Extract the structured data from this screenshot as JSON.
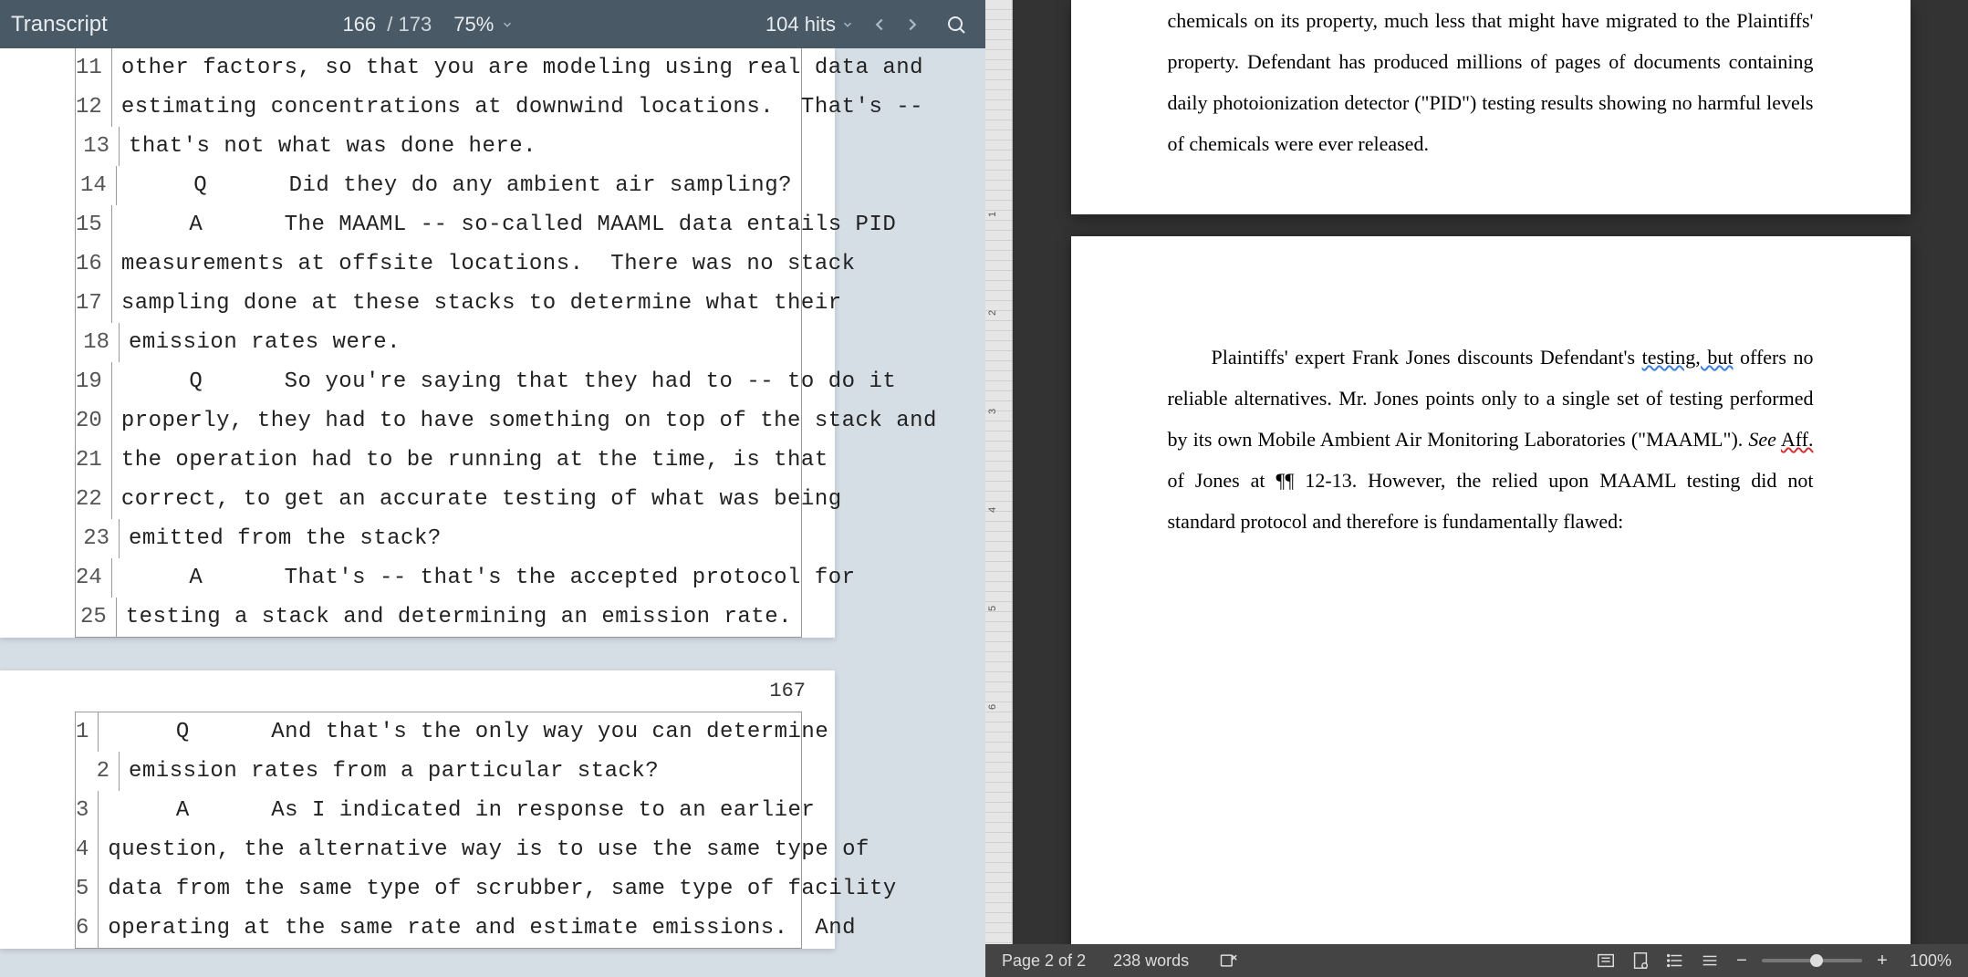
{
  "left": {
    "title": "Transcript",
    "current_page": "166",
    "page_sep": "/ 173",
    "zoom": "75%",
    "hits": "104 hits",
    "page166": {
      "lines": [
        {
          "n": "11",
          "t": "other factors, so that you are modeling using real data and"
        },
        {
          "n": "12",
          "t": "estimating concentrations at downwind locations.  That's --"
        },
        {
          "n": "13",
          "t": "that's not what was done here."
        },
        {
          "n": "14",
          "t": "     Q      Did they do any ambient air sampling?"
        },
        {
          "n": "15",
          "t": "     A      The MAAML -- so-called MAAML data entails PID"
        },
        {
          "n": "16",
          "t": "measurements at offsite locations.  There was no stack"
        },
        {
          "n": "17",
          "t": "sampling done at these stacks to determine what their"
        },
        {
          "n": "18",
          "t": "emission rates were."
        },
        {
          "n": "19",
          "t": "     Q      So you're saying that they had to -- to do it"
        },
        {
          "n": "20",
          "t": "properly, they had to have something on top of the stack and"
        },
        {
          "n": "21",
          "t": "the operation had to be running at the time, is that"
        },
        {
          "n": "22",
          "t": "correct, to get an accurate testing of what was being"
        },
        {
          "n": "23",
          "t": "emitted from the stack?"
        },
        {
          "n": "24",
          "t": "     A      That's -- that's the accepted protocol for"
        },
        {
          "n": "25",
          "t": "testing a stack and determining an emission rate."
        }
      ]
    },
    "page167": {
      "num": "167",
      "lines": [
        {
          "n": "1",
          "t": "     Q      And that's the only way you can determine"
        },
        {
          "n": "2",
          "t": "emission rates from a particular stack?"
        },
        {
          "n": "3",
          "t": "     A      As I indicated in response to an earlier"
        },
        {
          "n": "4",
          "t": "question, the alternative way is to use the same type of"
        },
        {
          "n": "5",
          "t": "data from the same type of scrubber, same type of facility"
        },
        {
          "n": "6",
          "t": "operating at the same rate and estimate emissions.  And"
        }
      ]
    }
  },
  "right": {
    "page1": {
      "p1_a": "chemicals on its property, much less that might have migrated to the Plaintiffs' property.  Defendant has produced millions of pages of documents containing daily photoionization detector (\"PID\") testing results showing no harmful levels of chemicals were ever released."
    },
    "page2": {
      "p_pre_testing": "Plaintiffs' expert Frank Jones discounts Defendant's ",
      "testing_but": "testing, but",
      "p_post_testing": " offers no reliable alternatives.  Mr. Jones points only to a single set of testing performed by its own Mobile Ambient Air Monitoring Laboratories (\"MAAML\").  ",
      "see": "See",
      "aff": "Aff.",
      "post_aff": " of Jones at ¶¶ 12-13.  However, the relied upon MAAML testing did not standard protocol and therefore is fundamentally flawed:"
    },
    "ruler_ticks": [
      "1",
      "2",
      "3",
      "4",
      "5",
      "6"
    ],
    "status": {
      "page": "Page 2 of 2",
      "words": "238 words",
      "zoom": "100%"
    }
  }
}
